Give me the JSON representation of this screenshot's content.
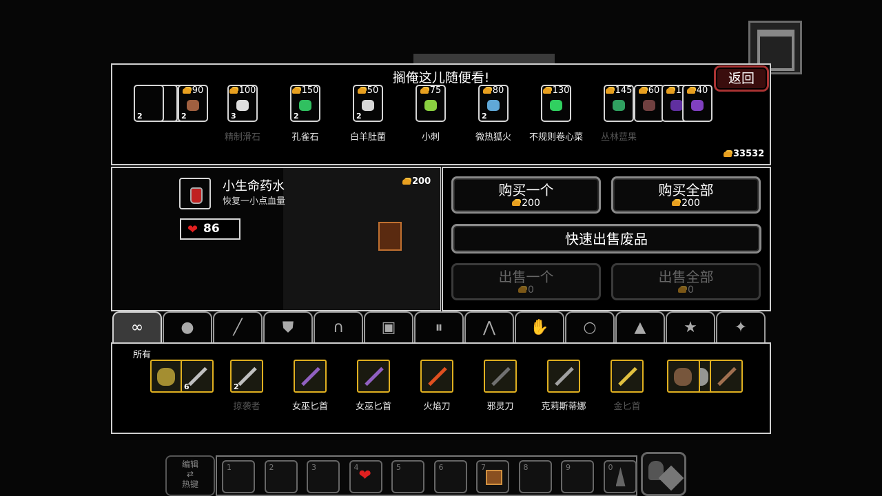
{
  "shop": {
    "title": "搁俺这儿随便看!",
    "back_label": "返回",
    "gold": "33532",
    "items": [
      {
        "price": "90",
        "count": "2",
        "name": ""
      },
      {
        "price": "100",
        "count": "3",
        "name": "精制滑石",
        "dim": true
      },
      {
        "price": "150",
        "count": "2",
        "name": "孔雀石"
      },
      {
        "price": "50",
        "count": "2",
        "name": "白羊肚菌"
      },
      {
        "price": "75",
        "count": "",
        "name": "小刺"
      },
      {
        "price": "80",
        "count": "2",
        "name": "微热狐火"
      },
      {
        "price": "130",
        "count": "",
        "name": "不规则卷心菜"
      },
      {
        "price": "145",
        "count": "",
        "name": "丛林蓝果",
        "dim": true
      },
      {
        "price": "60",
        "count": "",
        "name": ""
      },
      {
        "price": "10",
        "count": "",
        "name": ""
      },
      {
        "price": "40",
        "count": "",
        "name": ""
      }
    ]
  },
  "selected": {
    "name": "小生命药水",
    "description": "恢复一小点血量",
    "price": "200",
    "hp": "86"
  },
  "actions": {
    "buy_one": {
      "label": "购买一个",
      "price": "200"
    },
    "buy_all": {
      "label": "购买全部",
      "price": "200"
    },
    "quick_sell": {
      "label": "快速出售废品"
    },
    "sell_one": {
      "label": "出售一个",
      "price": "0"
    },
    "sell_all": {
      "label": "出售全部",
      "price": "0"
    }
  },
  "tabs": {
    "active_label": "所有",
    "icons": [
      "infinity-icon",
      "bag-icon",
      "sword-icon",
      "shield-icon",
      "helmet-icon",
      "armor-icon",
      "pants-icon",
      "boots-icon",
      "glove-icon",
      "ring-icon",
      "hat-icon",
      "star-icon",
      "wand-icon"
    ]
  },
  "inventory": [
    {
      "name": "",
      "count": "6"
    },
    {
      "name": "掠袭者",
      "count": "2",
      "dim": true
    },
    {
      "name": "女巫匕首",
      "count": ""
    },
    {
      "name": "女巫匕首",
      "count": ""
    },
    {
      "name": "火焰刀",
      "count": ""
    },
    {
      "name": "邪灵刀",
      "count": ""
    },
    {
      "name": "克莉斯蒂娜",
      "count": ""
    },
    {
      "name": "金匕首",
      "count": "",
      "dim": true
    },
    {
      "name": "",
      "count": ""
    }
  ],
  "hotbar": {
    "edit_top": "编辑",
    "edit_bottom": "热键",
    "slots": [
      "1",
      "2",
      "3",
      "4",
      "5",
      "6",
      "7",
      "8",
      "9",
      "0"
    ]
  }
}
